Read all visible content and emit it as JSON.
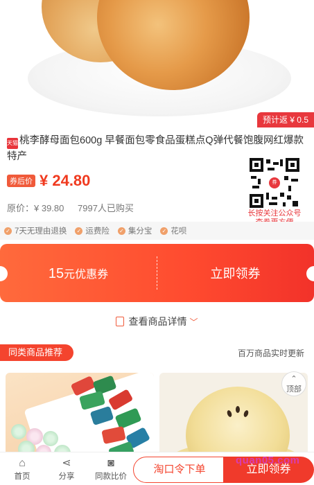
{
  "product": {
    "rebate_label": "预计返 ¥ 0.5",
    "store_badge": "天猫",
    "title": "桃李酵母面包600g 早餐面包零食品蛋糕点Q弹代餐饱腹网红爆款特产",
    "coupon_price_tag": "券后价",
    "price": "¥ 24.80",
    "original_price": "原价：¥ 39.80",
    "sold_count": "7997人已购买"
  },
  "qr": {
    "center_glyph": "券",
    "caption_line1": "长按关注公众号",
    "caption_line2": "查券更方便"
  },
  "services": [
    "7天无理由退换",
    "运费险",
    "集分宝",
    "花呗"
  ],
  "coupon": {
    "amount": "15",
    "amount_suffix": "元优惠券",
    "claim_label": "立即领券"
  },
  "details_link": "查看商品详情",
  "similar": {
    "title": "同类商品推荐",
    "subtitle": "百万商品实时更新"
  },
  "top_button": "顶部",
  "bottom_nav": {
    "home": "首页",
    "share": "分享",
    "compare": "同款比价",
    "taokouling": "淘口令下单",
    "claim": "立即领券"
  },
  "watermark": "quan05.com",
  "colors": {
    "accent": "#f03a2b",
    "coupon_gradient_start": "#ff6a3c",
    "coupon_gradient_end": "#f2322a"
  }
}
